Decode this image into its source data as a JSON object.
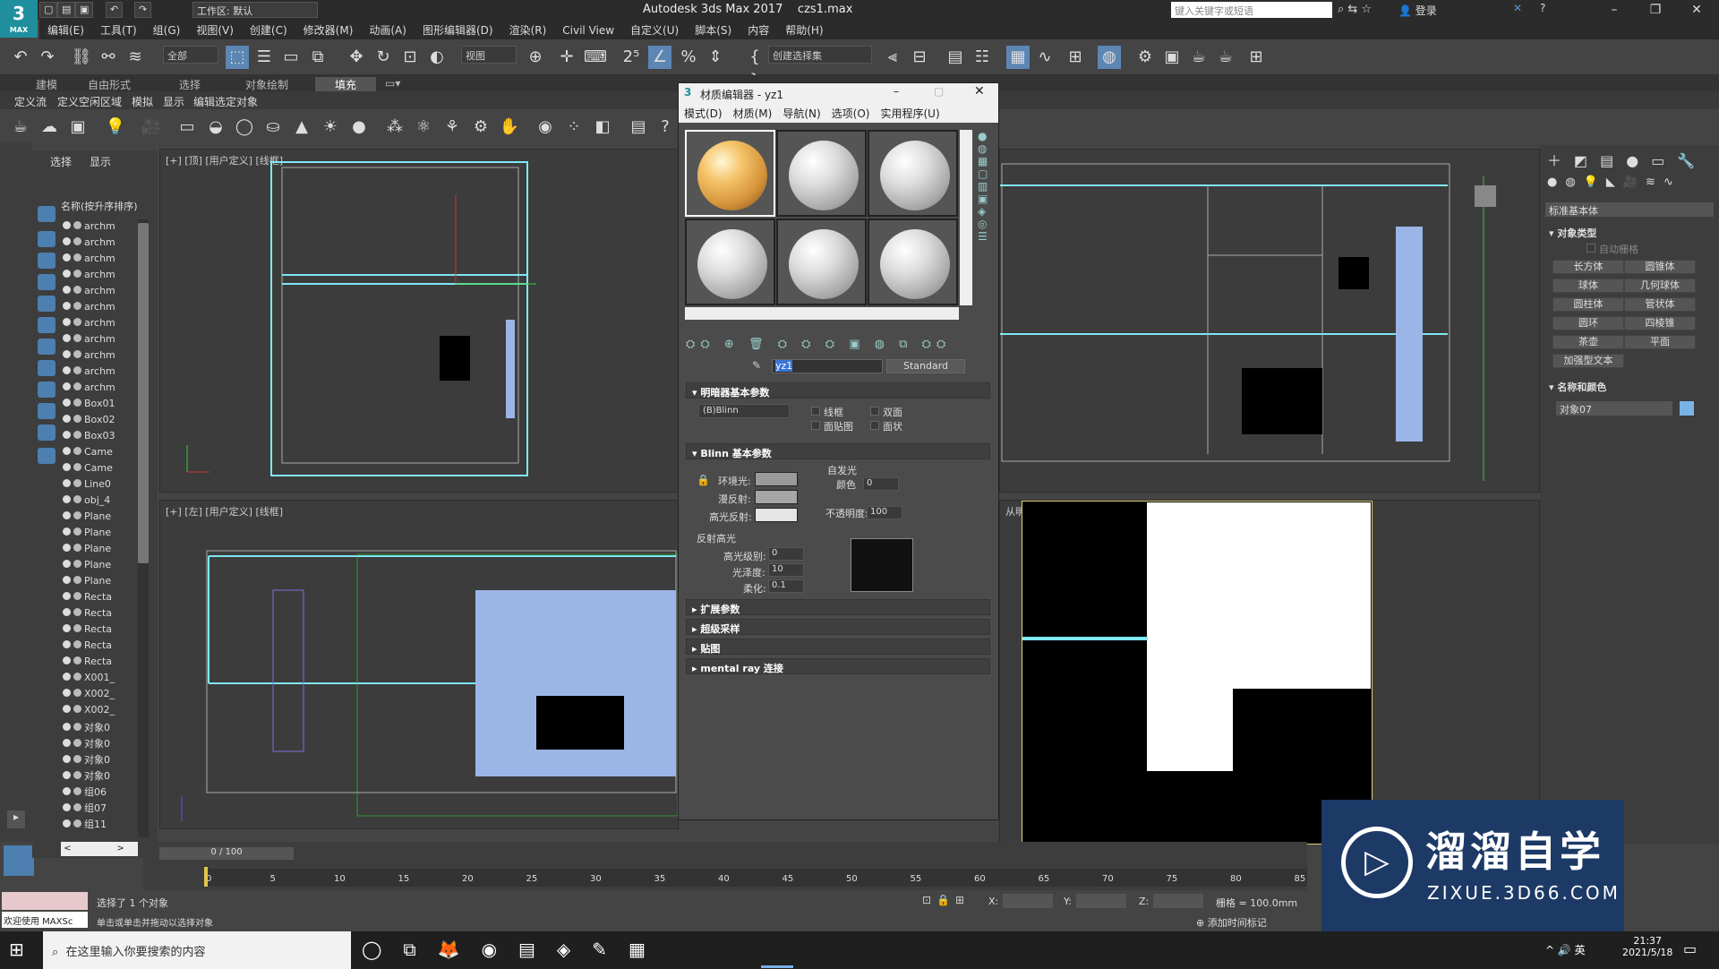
{
  "app": {
    "title": "Autodesk 3ds Max 2017",
    "file": "czs1.max",
    "logo": "MAX",
    "workspace": "工作区: 默认",
    "search_placeholder": "键入关键字或短语",
    "login": "登录"
  },
  "menu": [
    "编辑(E)",
    "工具(T)",
    "组(G)",
    "视图(V)",
    "创建(C)",
    "修改器(M)",
    "动画(A)",
    "图形编辑器(D)",
    "渲染(R)",
    "Civil View",
    "自定义(U)",
    "脚本(S)",
    "内容",
    "帮助(H)"
  ],
  "toolbar": {
    "filter": "全部",
    "refcoord": "视图",
    "selset": "创建选择集"
  },
  "ribbon_tabs": [
    "建模",
    "自由形式",
    "选择",
    "对象绘制",
    "填充"
  ],
  "ribbon_row2": [
    "定义流",
    "定义空闲区域",
    "模拟",
    "显示",
    "编辑选定对象"
  ],
  "scene": {
    "tabs": [
      "选择",
      "显示"
    ],
    "header": "名称(按升序排序)",
    "items": [
      "archm",
      "archm",
      "archm",
      "archm",
      "archm",
      "archm",
      "archm",
      "archm",
      "archm",
      "archm",
      "archm",
      "Box01",
      "Box02",
      "Box03",
      "Came",
      "Came",
      "Line0",
      "obj_4",
      "Plane",
      "Plane",
      "Plane",
      "Plane",
      "Plane",
      "Recta",
      "Recta",
      "Recta",
      "Recta",
      "Recta",
      "X001_",
      "X002_",
      "X002_",
      "对象0",
      "对象0",
      "对象0",
      "对象0",
      "组06",
      "组07",
      "组11"
    ]
  },
  "viewports": {
    "top": "[+] [顶] [用户定义] [线框]",
    "left": "[+] [左] [用户定义] [线框]",
    "persp": "从明暗处理 ]"
  },
  "mated": {
    "title": "材质编辑器 - yz1",
    "menu": [
      "模式(D)",
      "材质(M)",
      "导航(N)",
      "选项(O)",
      "实用程序(U)"
    ],
    "matname": "yz1",
    "mattype": "Standard",
    "shader_header": "明暗器基本参数",
    "shader": "(B)Blinn",
    "shader_opts": [
      "线框",
      "双面",
      "面贴图",
      "面状"
    ],
    "blinn_header": "Blinn 基本参数",
    "ambient": "环境光:",
    "diffuse": "漫反射:",
    "specular": "高光反射:",
    "selfillum": "自发光",
    "color_label": "颜色",
    "selfillum_val": "0",
    "opacity_label": "不透明度:",
    "opacity": "100",
    "spec_header": "反射高光",
    "spec_level_label": "高光级别:",
    "spec_level": "0",
    "gloss_label": "光泽度:",
    "gloss": "10",
    "soften_label": "柔化:",
    "soften": "0.1",
    "rollouts": [
      "扩展参数",
      "超级采样",
      "贴图",
      "mental ray 连接"
    ],
    "colors": {
      "ambient": "#9a9a9a",
      "diffuse": "#a6a6a6",
      "specular": "#e5e5e5"
    }
  },
  "cmdpanel": {
    "category": "标准基本体",
    "objtype_header": "对象类型",
    "autogrid": "自动栅格",
    "buttons": [
      "长方体",
      "圆锥体",
      "球体",
      "几何球体",
      "圆柱体",
      "管状体",
      "圆环",
      "四棱锥",
      "茶壶",
      "平面",
      "加强型文本"
    ],
    "name_header": "名称和颜色",
    "objname": "对象07",
    "objcolor": "#7ab3e8"
  },
  "timeline": {
    "frame": "0 / 100",
    "ticks": [
      "0",
      "5",
      "10",
      "15",
      "20",
      "25",
      "30",
      "35",
      "40",
      "45",
      "50",
      "55",
      "60",
      "65",
      "70",
      "75",
      "80",
      "85"
    ]
  },
  "status": {
    "welcome": "欢迎使用 MAXSc",
    "line1": "选择了 1 个对象",
    "line2": "单击或单击并拖动以选择对象",
    "x": "X:",
    "y": "Y:",
    "z": "Z:",
    "grid": "栅格 = 100.0mm",
    "addtime": "添加时间标记"
  },
  "taskbar": {
    "search": "在这里输入你要搜索的内容",
    "time": "21:37",
    "date": "2021/5/18",
    "lang": "英"
  },
  "watermark": {
    "name": "溜溜自学",
    "url": "ZIXUE.3D66.COM"
  }
}
